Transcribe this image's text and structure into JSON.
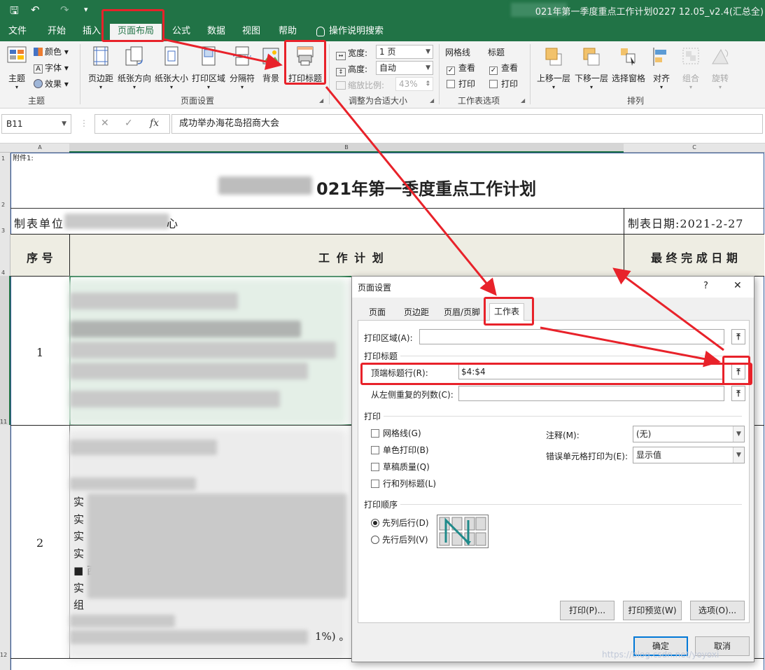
{
  "titlebar": {
    "doc_title": "021年第一季度重点工作计划0227 12.05_v2.4(汇总全)",
    "qa_save": "🖫",
    "qa_undo": "↶",
    "qa_redo": "↷",
    "qa_more": "▾"
  },
  "tabs": [
    "文件",
    "开始",
    "插入",
    "页面布局",
    "公式",
    "数据",
    "视图",
    "帮助",
    "操作说明搜索"
  ],
  "ribbon": {
    "theme": {
      "main": "主题",
      "colors": "颜色",
      "fonts": "字体",
      "effects": "效果",
      "group": "主题"
    },
    "page_setup": {
      "margins": "页边距",
      "orientation": "纸张方向",
      "size": "纸张大小",
      "print_area": "打印区域",
      "breaks": "分隔符",
      "background": "背景",
      "print_titles": "打印标题",
      "group": "页面设置"
    },
    "scale": {
      "width_label": "宽度:",
      "width_value": "1 页",
      "height_label": "高度:",
      "height_value": "自动",
      "scale_label": "缩放比例:",
      "scale_value": "43%",
      "group": "调整为合适大小"
    },
    "sheet_options": {
      "gridlines": "网格线",
      "headings": "标题",
      "view": "查看",
      "print": "打印",
      "group": "工作表选项"
    },
    "arrange": {
      "bring_forward": "上移一层",
      "send_backward": "下移一层",
      "selection_pane": "选择窗格",
      "align": "对齐",
      "group_btn": "组合",
      "rotate": "旋转",
      "group": "排列"
    }
  },
  "formula_bar": {
    "name_box": "B11",
    "formula": "成功举办海花岛招商大会",
    "fx": "fx"
  },
  "sheet": {
    "col_headers": [
      "A",
      "B",
      "C"
    ],
    "row_headers": [
      "1",
      "2",
      "3",
      "4",
      "11",
      "12"
    ],
    "attachment": "附件1:",
    "title": "021年第一季度重点工作计划",
    "unit_label_left": "制表单位",
    "unit_label_right": "心",
    "date_label": "制表日期:2021-2-27",
    "header_seq": "序 号",
    "header_plan": "工 作 计 划",
    "header_date": "最 终 完 成 日 期",
    "big_char": "第",
    "row1_num": "1",
    "row2_num": "2",
    "row2_lines": [
      "实",
      "实",
      "实",
      "实",
      "■ 西",
      "实",
      "组"
    ],
    "row2_tail": "1%) 。"
  },
  "dialog": {
    "title": "页面设置",
    "help": "?",
    "close": "✕",
    "tabs": [
      "页面",
      "页边距",
      "页眉/页脚",
      "工作表"
    ],
    "print_area_label": "打印区域(A):",
    "print_titles_label": "打印标题",
    "rows_to_repeat_label": "顶端标题行(R):",
    "rows_to_repeat_value": "$4:$4",
    "cols_to_repeat_label": "从左侧重复的列数(C):",
    "print_label": "打印",
    "checks": [
      "网格线(G)",
      "单色打印(B)",
      "草稿质量(Q)",
      "行和列标题(L)"
    ],
    "comments_label": "注释(M):",
    "comments_value": "(无)",
    "errors_label": "错误单元格打印为(E):",
    "errors_value": "显示值",
    "order_label": "打印顺序",
    "order_options": [
      "先列后行(D)",
      "先行后列(V)"
    ],
    "btn_print": "打印(P)...",
    "btn_preview": "打印预览(W)",
    "btn_options": "选项(O)...",
    "btn_ok": "确定",
    "btn_cancel": "取消"
  },
  "watermark": "https://blog.csdn.net/yoyoxi",
  "colors": {
    "excel_green": "#217346",
    "annotation_red": "#e8222a"
  }
}
